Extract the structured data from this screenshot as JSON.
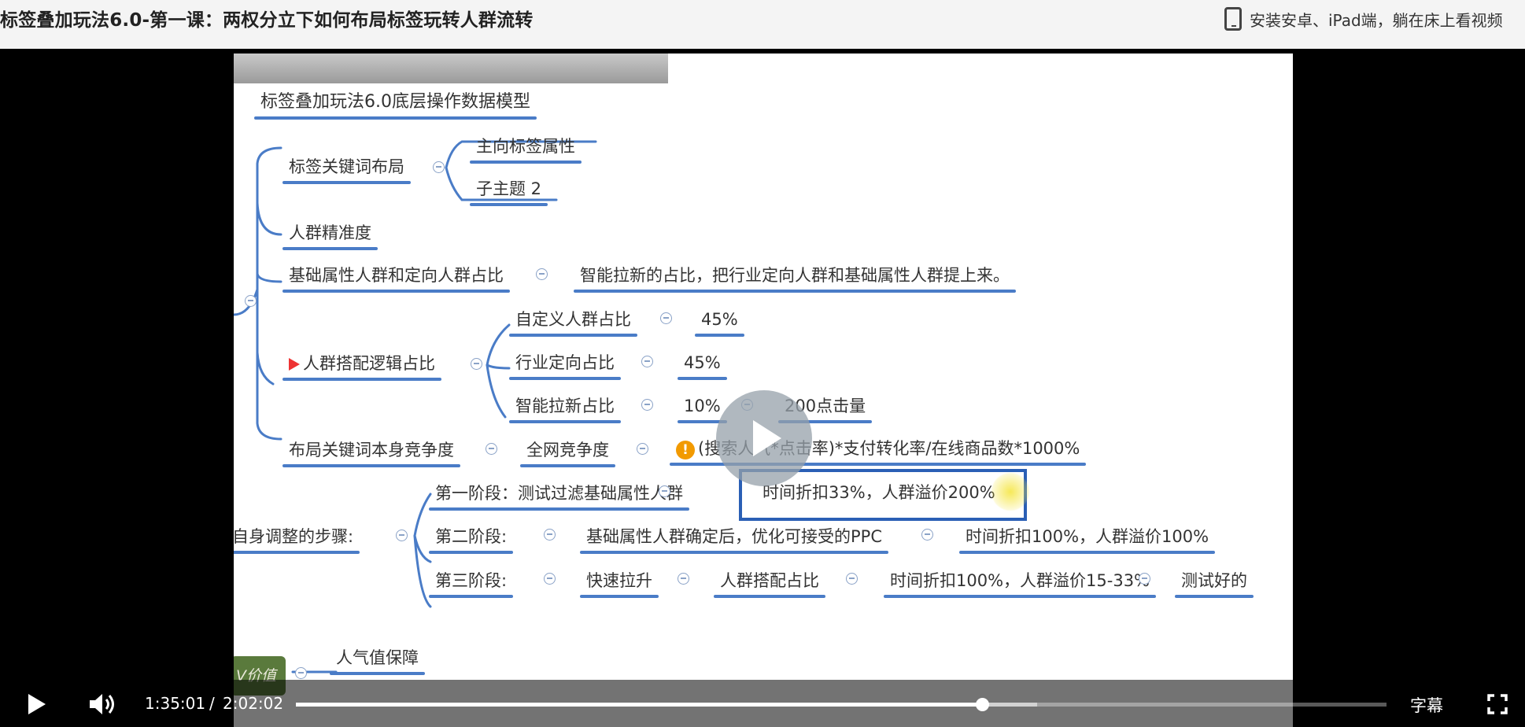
{
  "page": {
    "title": "标签叠加玩法6.0-第一课：两权分立下如何布局标签玩转人群流转",
    "app_promo": "安装安卓、iPad端，躺在床上看视频"
  },
  "mindmap": {
    "root": "标签叠加玩法6.0底层操作数据模型",
    "tag_layout": "标签关键词布局",
    "tag_layout_children": [
      "主向标签属性",
      "子主题 2"
    ],
    "crowd_precision": "人群精准度",
    "base_ratio": "基础属性人群和定向人群占比",
    "base_ratio_note": "智能拉新的占比，把行业定向人群和基础属性人群提上来。",
    "crowd_mix": "人群搭配逻辑占比",
    "crowd_mix_children": [
      {
        "label": "自定义人群占比",
        "value": "45%"
      },
      {
        "label": "行业定向占比",
        "value": "45%"
      },
      {
        "label": "智能拉新占比",
        "value": "10%",
        "extra": "200点击量"
      }
    ],
    "keyword_competition": "布局关键词本身竞争度",
    "network_competition": "全网竞争度",
    "formula": "(搜索人气*点击率)*支付转化率/在线商品数*1000%",
    "steps": "自身调整的步骤:",
    "stage1": "第一阶段：测试过滤基础属性人群",
    "stage1_note": "时间折扣33%，人群溢价200%",
    "stage2": "第二阶段:",
    "stage2_note": "基础属性人群确定后，优化可接受的PPC",
    "stage2_value": "时间折扣100%，人群溢价100%",
    "stage3": "第三阶段:",
    "stage3_a": "快速拉升",
    "stage3_b": "人群搭配占比",
    "stage3_c": "时间折扣100%，人群溢价15-33%",
    "stage3_d": "测试好的",
    "value_badge": "V价值",
    "popularity": "人气值保障"
  },
  "controls": {
    "current_time": "1:35:01",
    "separator": "/",
    "duration": "2:02:02",
    "progress": 0.629,
    "buffered": 0.68,
    "subtitle": "字幕"
  },
  "icons": [
    "tablet-icon",
    "play-icon",
    "volume-icon",
    "fullscreen-icon",
    "big-play-icon",
    "flag-icon",
    "warning-icon"
  ]
}
